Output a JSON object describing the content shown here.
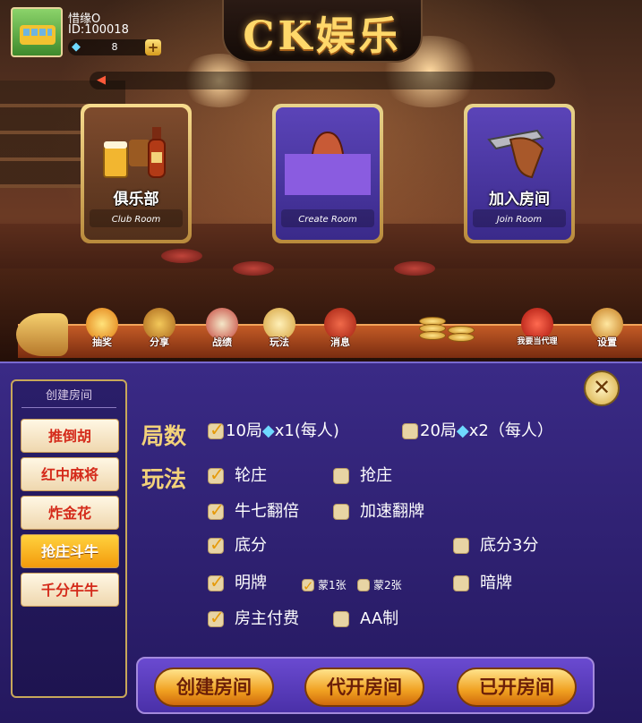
{
  "user": {
    "nickname": "惜缘O",
    "id_label": "ID:100018",
    "gems": "8",
    "add_label": "+"
  },
  "logo": {
    "text": "CK娱乐"
  },
  "mode_cards": [
    {
      "title": "俱乐部",
      "subtitle": "Club Room"
    },
    {
      "title": "",
      "subtitle": "Create Room"
    },
    {
      "title": "加入房间",
      "subtitle": "Join Room"
    }
  ],
  "nav": [
    {
      "label": "抽奖",
      "icon": "lottery-icon"
    },
    {
      "label": "分享",
      "icon": "share-icon"
    },
    {
      "label": "战绩",
      "icon": "record-icon"
    },
    {
      "label": "玩法",
      "icon": "rules-icon"
    },
    {
      "label": "消息",
      "icon": "message-icon"
    },
    {
      "label": "我要当代理",
      "icon": "agent-icon"
    },
    {
      "label": "设置",
      "icon": "settings-icon"
    }
  ],
  "dialog": {
    "side_title": "创建房间",
    "games": [
      "推倒胡",
      "红中麻将",
      "炸金花",
      "抢庄斗牛",
      "千分牛牛"
    ],
    "active_game_index": 3,
    "rounds_title": "局数",
    "rounds": [
      {
        "label_a": "10局",
        "label_b": "x1(每人)",
        "checked": true
      },
      {
        "label_a": "20局",
        "label_b": "x2（每人）",
        "checked": false
      }
    ],
    "play_title": "玩法",
    "options": {
      "lunzhuang": {
        "label": "轮庄",
        "checked": true
      },
      "qiangzhuang": {
        "label": "抢庄",
        "checked": false
      },
      "niuqi": {
        "label": "牛七翻倍",
        "checked": true
      },
      "jiasu": {
        "label": "加速翻牌",
        "checked": false
      },
      "difen": {
        "label": "底分",
        "checked": true
      },
      "difen3": {
        "label": "底分3分",
        "checked": false
      },
      "mingpai": {
        "label": "明牌",
        "checked": true
      },
      "meng1": {
        "label": "蒙1张",
        "checked": true
      },
      "meng2": {
        "label": "蒙2张",
        "checked": false
      },
      "anpai": {
        "label": "暗牌",
        "checked": false
      },
      "fangzhu": {
        "label": "房主付费",
        "checked": true
      },
      "aa": {
        "label": "AA制",
        "checked": false
      }
    },
    "actions": [
      "创建房间",
      "代开房间",
      "已开房间"
    ],
    "close_label": "✕"
  },
  "icons": {
    "gem": "◆",
    "speaker": "◀",
    "check": "✓"
  }
}
